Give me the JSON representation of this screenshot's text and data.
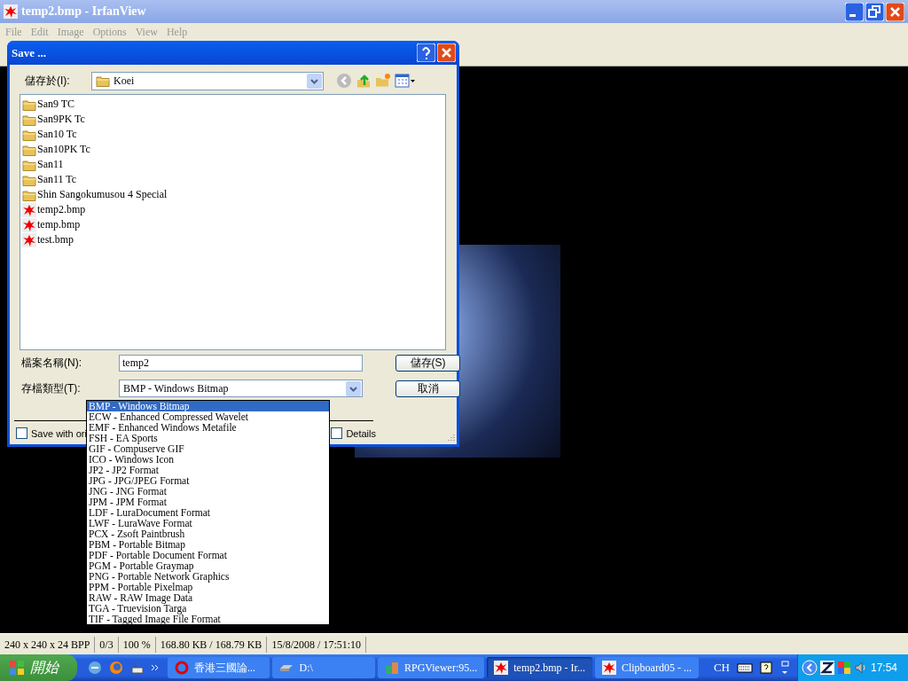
{
  "window": {
    "title": "temp2.bmp - IrfanView"
  },
  "menu": [
    "File",
    "Edit",
    "Image",
    "Options",
    "View",
    "Help"
  ],
  "dialog": {
    "title": "Save ...",
    "look_in_label": "儲存於(I):",
    "look_in_value": "Koei",
    "files": [
      {
        "name": "San9 TC",
        "kind": "folder"
      },
      {
        "name": "San9PK Tc",
        "kind": "folder"
      },
      {
        "name": "San10 Tc",
        "kind": "folder"
      },
      {
        "name": "San10PK Tc",
        "kind": "folder"
      },
      {
        "name": "San11",
        "kind": "folder"
      },
      {
        "name": "San11 Tc",
        "kind": "folder"
      },
      {
        "name": "Shin Sangokumusou 4 Special",
        "kind": "folder"
      },
      {
        "name": "temp2.bmp",
        "kind": "image"
      },
      {
        "name": "temp.bmp",
        "kind": "image"
      },
      {
        "name": "test.bmp",
        "kind": "image"
      }
    ],
    "file_name_label": "檔案名稱(N):",
    "file_name_value": "temp2",
    "save_button": "儲存(S)",
    "type_label": "存檔類型(T):",
    "type_value": "BMP - Windows Bitmap",
    "cancel_button": "取消",
    "options": [
      {
        "label": "Save with ori",
        "checked": false
      },
      {
        "label": "Details",
        "checked": false
      }
    ]
  },
  "type_dropdown": [
    {
      "label": "BMP - Windows Bitmap",
      "selected": true
    },
    {
      "label": "ECW - Enhanced Compressed Wavelet",
      "selected": false
    },
    {
      "label": "EMF - Enhanced Windows Metafile",
      "selected": false
    },
    {
      "label": "FSH - EA Sports",
      "selected": false
    },
    {
      "label": "GIF - Compuserve GIF",
      "selected": false
    },
    {
      "label": "ICO - Windows Icon",
      "selected": false
    },
    {
      "label": "JP2 - JP2 Format",
      "selected": false
    },
    {
      "label": "JPG - JPG/JPEG Format",
      "selected": false
    },
    {
      "label": "JNG - JNG Format",
      "selected": false
    },
    {
      "label": "JPM - JPM Format",
      "selected": false
    },
    {
      "label": "LDF - LuraDocument Format",
      "selected": false
    },
    {
      "label": "LWF - LuraWave Format",
      "selected": false
    },
    {
      "label": "PCX - Zsoft Paintbrush",
      "selected": false
    },
    {
      "label": "PBM - Portable Bitmap",
      "selected": false
    },
    {
      "label": "PDF - Portable Document Format",
      "selected": false
    },
    {
      "label": "PGM - Portable Graymap",
      "selected": false
    },
    {
      "label": "PNG - Portable Network Graphics",
      "selected": false
    },
    {
      "label": "PPM - Portable Pixelmap",
      "selected": false
    },
    {
      "label": "RAW - RAW Image Data",
      "selected": false
    },
    {
      "label": "TGA - Truevision Targa",
      "selected": false
    },
    {
      "label": "TIF - Tagged Image File Format",
      "selected": false
    }
  ],
  "status_bar": [
    "240 x 240 x 24 BPP",
    "0/3",
    "100 %",
    "168.80 KB / 168.79 KB",
    "15/8/2008 / 17:51:10"
  ],
  "taskbar": {
    "start": "開始",
    "tasks": [
      {
        "label": "香港三國論...",
        "kind": "browser",
        "selected": false
      },
      {
        "label": "D:\\",
        "kind": "drive",
        "selected": false
      },
      {
        "label": "RPGViewer:95...",
        "kind": "app",
        "selected": false
      },
      {
        "label": "temp2.bmp - Ir...",
        "kind": "image",
        "selected": true
      },
      {
        "label": "Clipboard05 - ...",
        "kind": "image",
        "selected": false
      }
    ],
    "language": "CH",
    "time": "17:54"
  }
}
